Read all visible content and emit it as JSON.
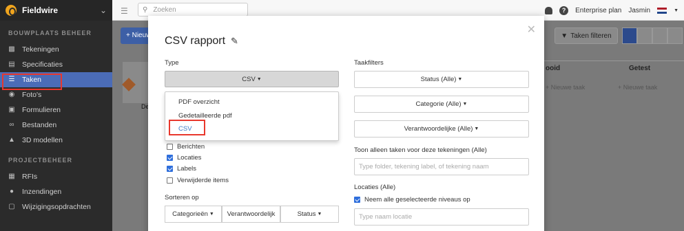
{
  "sidebar": {
    "brand": "Fieldwire",
    "section1": "BOUWPLAATS BEHEER",
    "items1": [
      {
        "label": "Tekeningen",
        "icon": "drawings-icon"
      },
      {
        "label": "Specificaties",
        "icon": "specifications-icon"
      },
      {
        "label": "Taken",
        "icon": "tasks-icon"
      },
      {
        "label": "Foto's",
        "icon": "camera-icon"
      },
      {
        "label": "Formulieren",
        "icon": "forms-icon"
      },
      {
        "label": "Bestanden",
        "icon": "paperclip-icon"
      },
      {
        "label": "3D modellen",
        "icon": "cube-icon"
      }
    ],
    "section2": "PROJECTBEHEER",
    "items2": [
      {
        "label": "RFIs",
        "icon": "rfi-icon"
      },
      {
        "label": "Inzendingen",
        "icon": "submittals-icon"
      },
      {
        "label": "Wijzigingsopdrachten",
        "icon": "change-orders-icon"
      }
    ]
  },
  "topbar": {
    "search_placeholder": "Zoeken",
    "plan": "Enterprise plan",
    "user": "Jasmin"
  },
  "background": {
    "new_button": "+ Nieuw",
    "filter_button": "Taken filteren",
    "columns": [
      "ooid",
      "Getest"
    ],
    "new_task": "+ Nieuwe taak",
    "card_label": "De"
  },
  "modal": {
    "title": "CSV rapport",
    "type_label": "Type",
    "type_value": "CSV",
    "dropdown": [
      "PDF overzicht",
      "Gedetailleerde pdf",
      "CSV"
    ],
    "checkboxes": [
      {
        "label": "Berichten",
        "checked": false
      },
      {
        "label": "Locaties",
        "checked": true
      },
      {
        "label": "Labels",
        "checked": true
      },
      {
        "label": "Verwijderde items",
        "checked": false
      }
    ],
    "sort_label": "Sorteren op",
    "sort_buttons": [
      "Categorieën",
      "Verantwoordelijk",
      "Status"
    ],
    "filters_label": "Taakfilters",
    "filter_status": "Status (Alle)",
    "filter_category": "Categorie (Alle)",
    "filter_responsible": "Verantwoordelijke (Alle)",
    "drawings_label": "Toon alleen taken voor deze tekeningen (Alle)",
    "drawings_placeholder": "Type folder, tekening label, of tekening naam",
    "locations_label": "Locaties (Alle)",
    "locations_checkbox": "Neem alle geselecteerde niveaus op",
    "location_placeholder": "Type naam locatie"
  }
}
